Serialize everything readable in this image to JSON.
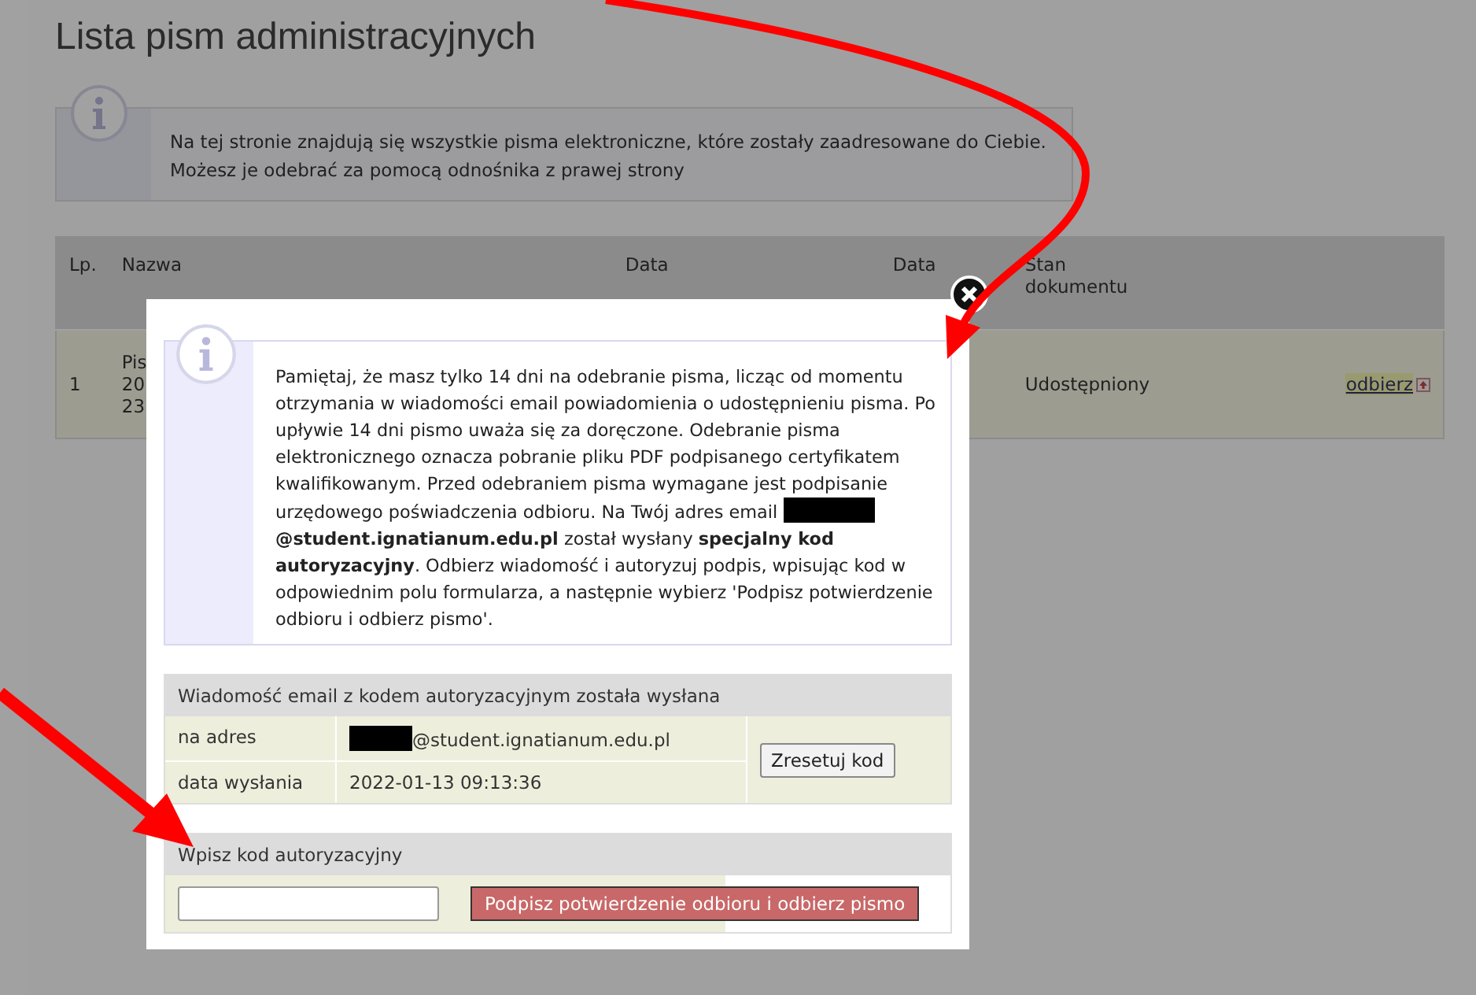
{
  "page": {
    "title": "Lista pism administracyjnych",
    "info": [
      "Na tej stronie znajdują się wszystkie pisma elektroniczne, które zostały zaadresowane do Ciebie.",
      "Możesz je odebrać za pomocą odnośnika z prawej strony"
    ]
  },
  "table": {
    "columns": [
      "Lp.",
      "Nazwa",
      "Data",
      "Data",
      "Stan dokumentu"
    ],
    "rows": [
      {
        "lp": "1",
        "name_lines": [
          "Pis",
          "20",
          "23"
        ],
        "status": "Udostępniony",
        "action": "odbierz"
      }
    ]
  },
  "dialog": {
    "notice_before": "Pamiętaj, że masz tylko 14 dni na odebranie pisma, licząc od momentu otrzymania w wiadomości email powiadomienia o udostępnieniu pisma. Po upływie 14 dni pismo uważa się za doręczone. Odebranie pisma elektronicznego oznacza pobranie pliku PDF podpisanego certyfikatem kwalifikowanym. Przed odebraniem pisma wymagane jest podpisanie urzędowego poświadczenia odbioru. Na Twój adres email ",
    "notice_redacted": true,
    "notice_after": "**@student.ignatianum.edu.pl** został wysłany **specjalny kod autoryzacyjny**. Odbierz wiadomość i autoryzuj podpis, wpisując kod w odpowiednim polu formularza, a następnie wybierz 'Podpisz potwierdzenie odbioru i odbierz pismo'.",
    "email_panel": {
      "title": "Wiadomość email z kodem autoryzacyjnym została wysłana",
      "rows": [
        {
          "label": "na adres",
          "value": "@student.ignatianum.edu.pl",
          "redacted": true
        },
        {
          "label": "data wysłania",
          "value": "2022-01-13 09:13:36",
          "redacted": false
        }
      ],
      "button": "Zresetuj kod"
    },
    "code_panel": {
      "title": "Wpisz kod autoryzacyjny",
      "button": "Podpisz potwierdzenie odbioru i odbierz pismo"
    }
  }
}
